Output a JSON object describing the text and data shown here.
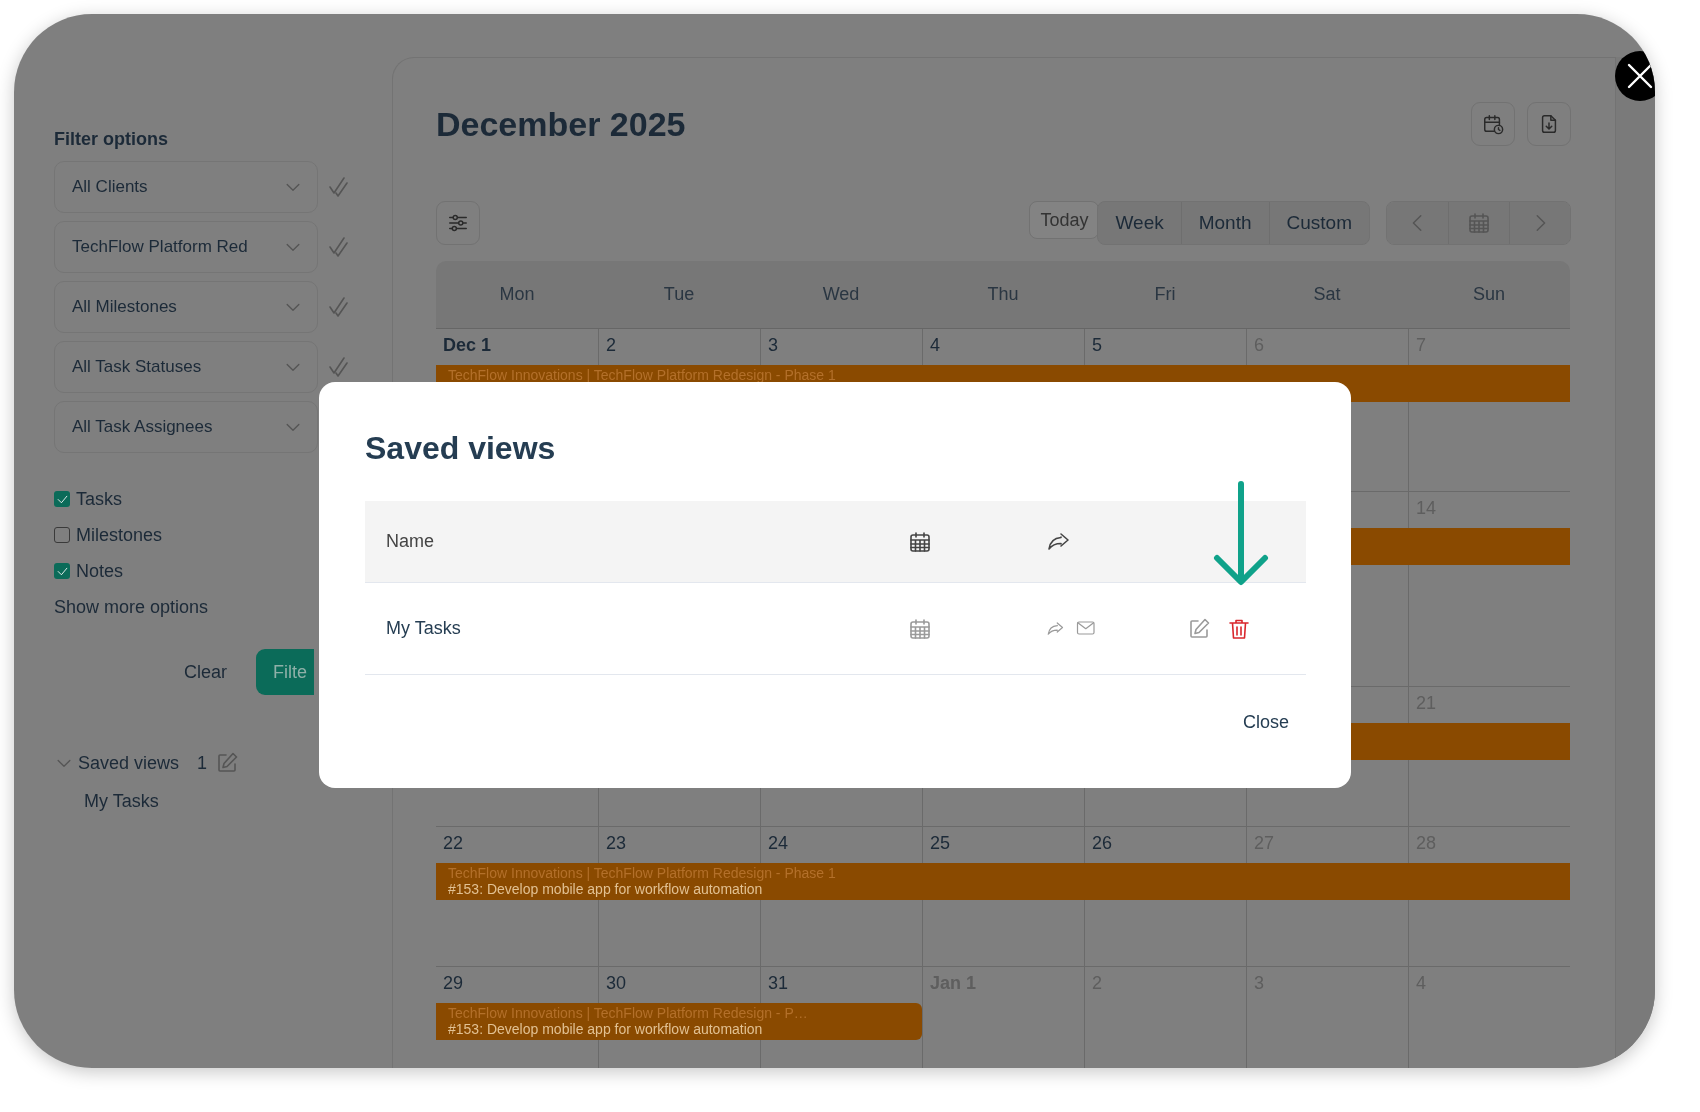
{
  "sidebar": {
    "heading": "Filter options",
    "filters": [
      {
        "value": "All Clients",
        "marked": true
      },
      {
        "value": "TechFlow Platform Red",
        "marked": true
      },
      {
        "value": "All Milestones",
        "marked": true
      },
      {
        "value": "All Task Statuses",
        "marked": true
      },
      {
        "value": "All Task Assignees",
        "marked": false
      }
    ],
    "toggles": [
      {
        "label": "Tasks",
        "checked": true
      },
      {
        "label": "Milestones",
        "checked": false
      },
      {
        "label": "Notes",
        "checked": true
      }
    ],
    "more_options": "Show more options",
    "clear_button": "Clear",
    "filter_button": "Filte",
    "saved_views": {
      "label": "Saved views",
      "count": "1",
      "expanded": true,
      "items": [
        {
          "name": "My Tasks"
        }
      ]
    }
  },
  "calendar": {
    "title": "December 2025",
    "view_buttons": [
      {
        "label": "Today",
        "kind": "standalone"
      },
      {
        "label": "Week",
        "kind": "grouped"
      },
      {
        "label": "Month",
        "kind": "grouped"
      },
      {
        "label": "Custom",
        "kind": "grouped"
      }
    ],
    "weekdays": [
      "Mon",
      "Tue",
      "Wed",
      "Thu",
      "Fri",
      "Sat",
      "Sun"
    ],
    "weeks": [
      {
        "days": [
          {
            "label": "Dec 1",
            "muted": false,
            "month_start": true
          },
          {
            "label": "2",
            "muted": false,
            "month_start": false
          },
          {
            "label": "3",
            "muted": false,
            "month_start": false
          },
          {
            "label": "4",
            "muted": false,
            "month_start": false
          },
          {
            "label": "5",
            "muted": false,
            "month_start": false
          },
          {
            "label": "6",
            "muted": true,
            "month_start": false
          },
          {
            "label": "7",
            "muted": true,
            "month_start": false
          }
        ],
        "events": [
          {
            "title": "TechFlow Innovations | TechFlow Platform Redesign - Phase 1",
            "kind": "full_week"
          }
        ]
      },
      {
        "days": [
          {
            "label": "14",
            "muted": true,
            "month_start": false
          }
        ],
        "events": [
          {
            "kind": "full_week"
          }
        ]
      },
      {
        "days": [
          {
            "label": "21",
            "muted": true,
            "month_start": false
          }
        ],
        "events": [
          {
            "kind": "full_week"
          }
        ]
      },
      {
        "days": [
          {
            "label": "22",
            "muted": false,
            "month_start": false
          },
          {
            "label": "23",
            "muted": false,
            "month_start": false
          },
          {
            "label": "24",
            "muted": false,
            "month_start": false
          },
          {
            "label": "25",
            "muted": false,
            "month_start": false
          },
          {
            "label": "26",
            "muted": false,
            "month_start": false
          },
          {
            "label": "27",
            "muted": true,
            "month_start": false
          },
          {
            "label": "28",
            "muted": true,
            "month_start": false
          }
        ],
        "events": [
          {
            "title": "TechFlow Innovations | TechFlow Platform Redesign - Phase 1",
            "detail": "#153: Develop mobile app for workflow automation",
            "kind": "full_week"
          }
        ]
      },
      {
        "days": [
          {
            "label": "29",
            "muted": false,
            "month_start": false
          },
          {
            "label": "30",
            "muted": false,
            "month_start": false
          },
          {
            "label": "31",
            "muted": false,
            "month_start": false
          },
          {
            "label": "Jan 1",
            "muted": true,
            "month_start": true
          },
          {
            "label": "2",
            "muted": true,
            "month_start": false
          },
          {
            "label": "3",
            "muted": true,
            "month_start": false
          },
          {
            "label": "4",
            "muted": true,
            "month_start": false
          }
        ],
        "events": [
          {
            "title": "TechFlow Innovations | TechFlow Platform Redesign - P…",
            "detail": "#153: Develop mobile app for workflow automation",
            "kind": "until_month_end"
          }
        ]
      }
    ]
  },
  "modal": {
    "title": "Saved views",
    "name_column": "Name",
    "rows": [
      {
        "name": "My Tasks"
      }
    ],
    "close_button": "Close"
  }
}
